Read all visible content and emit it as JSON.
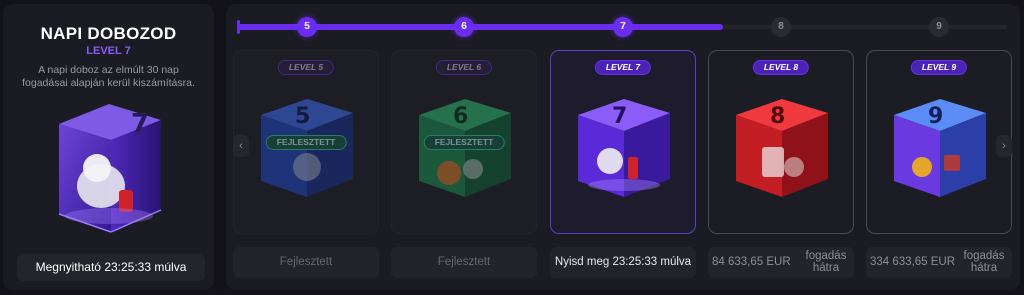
{
  "daily_box": {
    "title": "NAPI DOBOZOD",
    "level": "LEVEL 7",
    "description": "A napi doboz az elmúlt 30 nap fogadásai alapján kerül kiszámításra.",
    "timer_button": "Megnyitható 23:25:33 múlva",
    "cube_number": "7"
  },
  "progress": {
    "nodes": [
      "5",
      "6",
      "7",
      "8",
      "9"
    ],
    "completed_through": "7"
  },
  "cards": [
    {
      "level": "LEVEL 5",
      "number": "5",
      "badge": "FEJLESZTETT",
      "footer": "Fejlesztett",
      "color": "#2a54d8"
    },
    {
      "level": "LEVEL 6",
      "number": "6",
      "badge": "FEJLESZTETT",
      "footer": "Fejlesztett",
      "color": "#1f9a5a"
    },
    {
      "level": "LEVEL 7",
      "number": "7",
      "footer": "Nyisd meg 23:25:33 múlva",
      "color": "#7a35f0"
    },
    {
      "level": "LEVEL 8",
      "number": "8",
      "footer_amount": "84 633,65 EUR",
      "footer_label": "fogadás hátra",
      "color": "#e0252c"
    },
    {
      "level": "LEVEL 9",
      "number": "9",
      "footer_amount": "334 633,65 EUR",
      "footer_label": "fogadás hátra",
      "color": "#3d6fe0"
    }
  ],
  "icons": {
    "prev": "chevron-left-icon",
    "next": "chevron-right-icon"
  }
}
